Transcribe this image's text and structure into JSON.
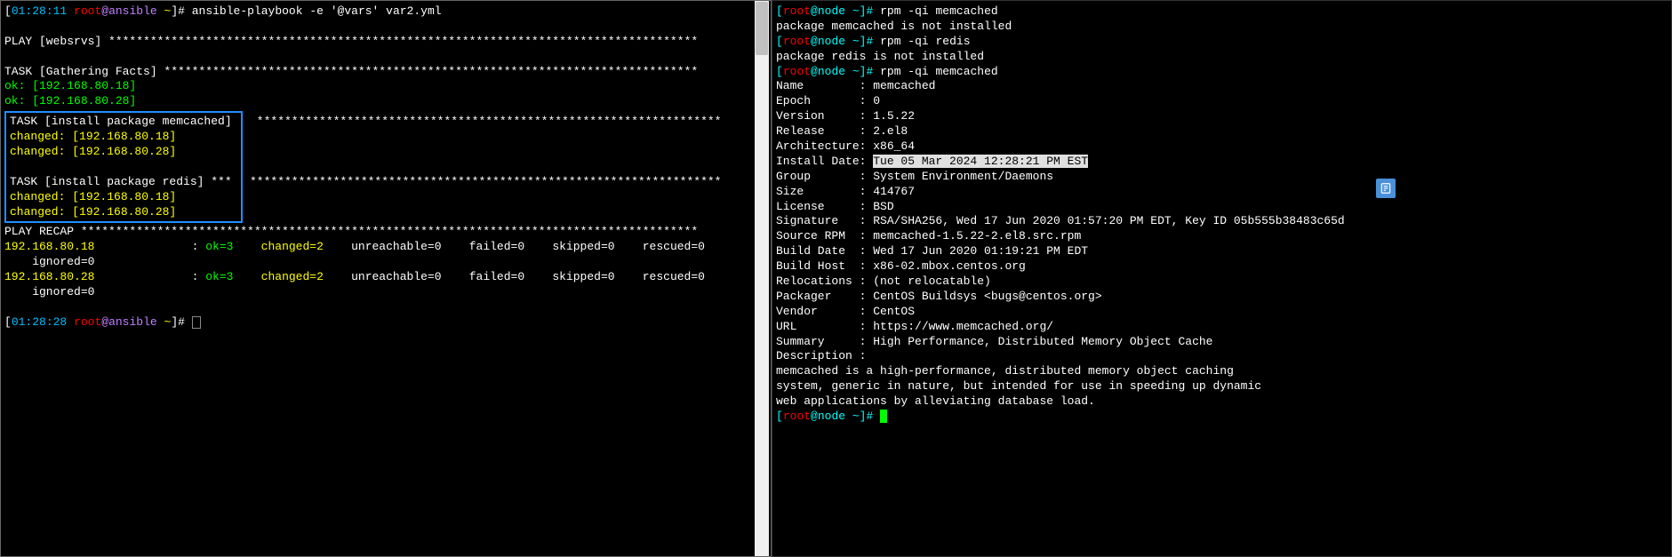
{
  "left": {
    "line1_ts": "01:28:11",
    "line1_user": "root",
    "line1_at": "@",
    "line1_host": "ansible",
    "line1_tilde": "~",
    "line1_cmd": "ansible-playbook -e '@vars' var2.yml",
    "play_header": "PLAY [websrvs] *************************************************************************************",
    "task_gather": "TASK [Gathering Facts] *****************************************************************************",
    "ok1": "ok: [192.168.80.18]",
    "ok2": "ok: [192.168.80.28]",
    "task_memcached": "TASK [install package memcached]",
    "stars_memcached": " *******************************************************************",
    "changed1": "changed: [192.168.80.18]",
    "changed2": "changed: [192.168.80.28]",
    "task_redis": "TASK [install package redis] ***",
    "stars_redis": "********************************************************************",
    "changed3": "changed: [192.168.80.18]",
    "changed4": "changed: [192.168.80.28]",
    "recap_header": "PLAY RECAP *****************************************************************************************",
    "host_18": "192.168.80.18",
    "host_28": "192.168.80.28",
    "colon_space": "              : ",
    "ok_eq": "ok=3",
    "changed_eq": "    changed=2",
    "rest_stats": "    unreachable=0    failed=0    skipped=0    rescued=0",
    "ignored": "    ignored=0",
    "line_last_ts": "01:28:28",
    "line_last_user": "root",
    "line_last_host": "ansible"
  },
  "right": {
    "p1_user": "root",
    "p1_host": "node",
    "p1_cmd": "rpm -qi memcached",
    "p1_out": "package memcached is not installed",
    "p2_cmd": "rpm -qi redis",
    "p2_out": "package redis is not installed",
    "p3_cmd": "rpm -qi memcached",
    "name": "Name        : memcached",
    "epoch": "Epoch       : 0",
    "version": "Version     : 1.5.22",
    "release": "Release     : 2.el8",
    "arch": "Architecture: x86_64",
    "installdate_label": "Install Date: ",
    "installdate_val": "Tue 05 Mar 2024 12:28:21 PM EST",
    "group": "Group       : System Environment/Daemons",
    "size": "Size        : 414767",
    "license": "License     : BSD",
    "signature": "Signature   : RSA/SHA256, Wed 17 Jun 2020 01:57:20 PM EDT, Key ID 05b555b38483c65d",
    "sourcerpm": "Source RPM  : memcached-1.5.22-2.el8.src.rpm",
    "builddate": "Build Date  : Wed 17 Jun 2020 01:19:21 PM EDT",
    "buildhost": "Build Host  : x86-02.mbox.centos.org",
    "relocations": "Relocations : (not relocatable)",
    "packager": "Packager    : CentOS Buildsys <bugs@centos.org>",
    "vendor": "Vendor      : CentOS",
    "url": "URL         : https://www.memcached.org/",
    "summary": "Summary     : High Performance, Distributed Memory Object Cache",
    "description": "Description :",
    "desc1": "memcached is a high-performance, distributed memory object caching",
    "desc2": "system, generic in nature, but intended for use in speeding up dynamic",
    "desc3": "web applications by alleviating database load."
  }
}
